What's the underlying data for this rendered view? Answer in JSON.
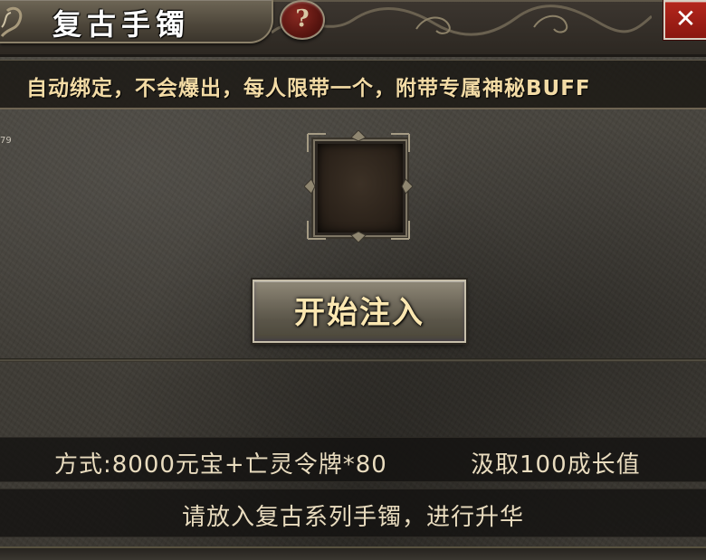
{
  "window": {
    "title": "复古手镯",
    "help_label": "?",
    "close_label": "✕"
  },
  "banner": {
    "text": "自动绑定，不会爆出，每人限带一个，附带专属神秘BUFF"
  },
  "edge_fragment": "79",
  "slot": {
    "icon": "empty-item-slot"
  },
  "action": {
    "label": "开始注入"
  },
  "cost": {
    "text": "方式:8000元宝+亡灵令牌*80",
    "growth": "汲取100成长值"
  },
  "hint": {
    "text": "请放入复古系列手镯，进行升华"
  },
  "colors": {
    "banner_text": "#f3dba5",
    "button_text": "#fbe7b1",
    "info_text": "#e9dcbf",
    "close_red": "#b4261c"
  }
}
